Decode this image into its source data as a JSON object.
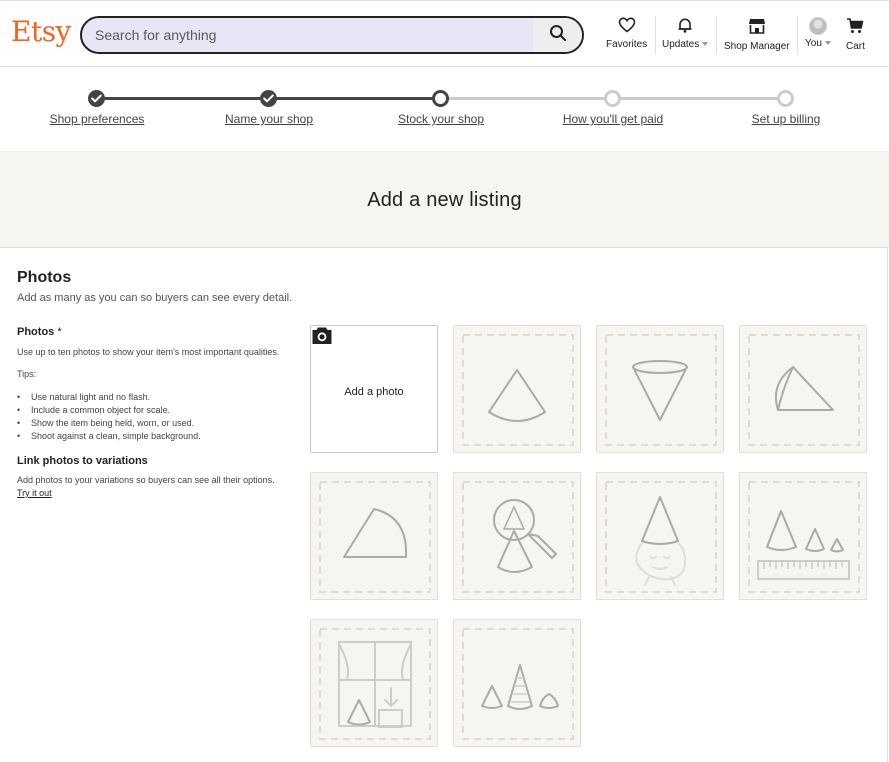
{
  "header": {
    "logo": "Etsy",
    "search": {
      "placeholder": "Search for anything"
    },
    "nav": {
      "favorites": "Favorites",
      "updates": "Updates",
      "shop_manager": "Shop Manager",
      "you": "You",
      "cart": "Cart"
    }
  },
  "progress": {
    "steps": [
      {
        "label": "Shop preferences",
        "state": "done"
      },
      {
        "label": "Name your shop",
        "state": "done"
      },
      {
        "label": "Stock your shop",
        "state": "current"
      },
      {
        "label": "How you'll get paid",
        "state": "todo"
      },
      {
        "label": "Set up billing",
        "state": "todo"
      }
    ]
  },
  "banner": {
    "title": "Add a new listing"
  },
  "photos": {
    "title": "Photos",
    "subtitle": "Add as many as you can so buyers can see every detail.",
    "field_label": "Photos",
    "required_mark": "*",
    "description": "Use up to ten photos to show your item's most important qualities.",
    "tips_heading": "Tips:",
    "tips": [
      "Use natural light and no flash.",
      "Include a common object for scale.",
      "Show the item being held, worn, or used.",
      "Shoot against a clean, simple background."
    ],
    "variations_label": "Link photos to variations",
    "variations_text": "Add photos to your variations so buyers can see all their options.",
    "try_link": "Try it out",
    "add_photo": "Add a photo"
  },
  "colors": {
    "brand": "#f1641e",
    "search_bg": "#e8e6f6",
    "tile_bg": "#f6f5f0",
    "step_done": "#444444",
    "step_todo": "#cccccc"
  }
}
